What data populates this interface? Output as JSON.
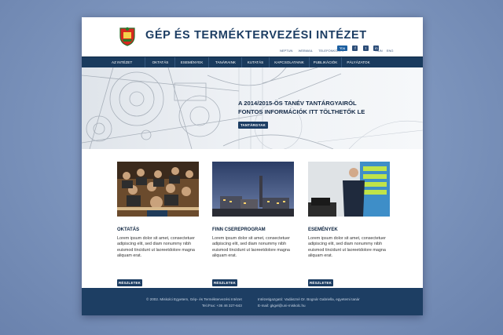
{
  "header": {
    "title": "GÉP ÉS TERMÉKTERVEZÉSI INTÉZET",
    "top_links": [
      "NEPTUN",
      "WEBMAIL",
      "TELEFONKÖNYV"
    ],
    "social": [
      "You",
      "f",
      "t",
      "in"
    ],
    "languages": [
      "HUN",
      "ENG"
    ]
  },
  "nav": {
    "items": [
      "AZ INTÉZET",
      "OKTATÁS",
      "ESEMÉNYEK",
      "TANÁRAINK",
      "KUTATÁS",
      "KAPCSOLATAINK",
      "PUBLIKÁCIÓK",
      "PÁLYÁZATOK"
    ]
  },
  "hero": {
    "title_line1": "A 2014/2015-ÖS TANÉV TANTÁRGYAIRÓL",
    "title_line2": "FONTOS INFORMÁCIÓK ITT TÖLTHETŐK LE",
    "button": "TANTÁRGYAK"
  },
  "cards": [
    {
      "title": "OKTATÁS",
      "text": "Lorem ipsum dolor sit amet, consectetuer adipiscing elit, sed diam nonummy nibh euismod tincidunt ut laoreetdolore magna aliquam erat.",
      "button": "RÉSZLETEK"
    },
    {
      "title": "FINN CSEREPROGRAM",
      "text": "Lorem ipsum dolor sit amet, consectetuer adipiscing elit, sed diam nonummy nibh euismod tincidunt ut laoreetdolore magna aliquam erat.",
      "button": "RÉSZLETEK"
    },
    {
      "title": "ESEMÉNYEK",
      "text": "Lorem ipsum dolor sit amet, consectetuer adipiscing elit, sed diam nonummy nibh euismod tincidunt ut laoreetdolore magna aliquam erat.",
      "button": "RÉSZLETEK"
    }
  ],
  "footer": {
    "copyright": "© 2002. Miskolci Egyetem, Gép- és Terméktervezési Intézet",
    "phone": "Tel./Fax: +36 46 327-643",
    "director": "Intézetigazgató: Vadászné Dr. Bognár Gabriella, egyetemi tanár",
    "email": "E-mail: gkgel@uni-miskolc.hu"
  },
  "colors": {
    "primary": "#1c3d63",
    "nav": "#1a3b5e",
    "footer": "#1d3e63"
  }
}
